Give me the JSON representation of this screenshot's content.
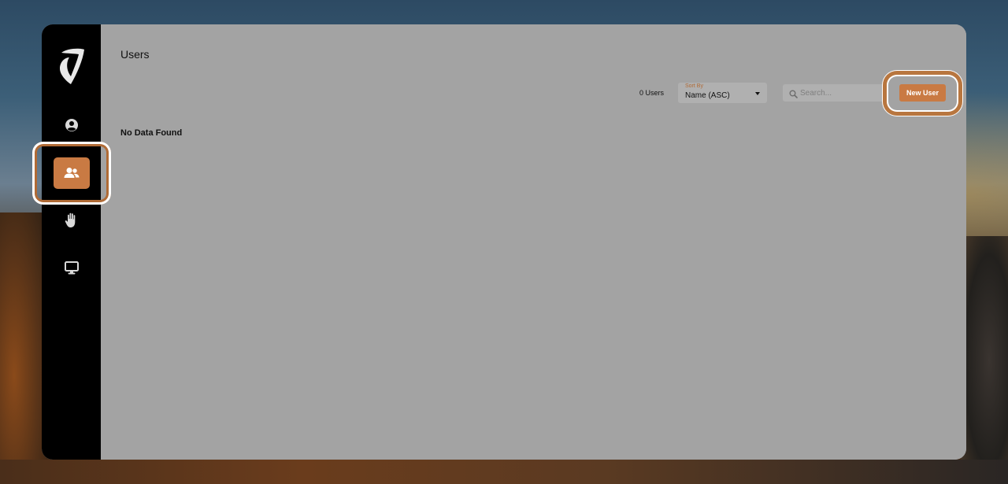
{
  "page": {
    "title": "Users"
  },
  "sidebar": {
    "items": [
      {
        "name": "profile",
        "icon": "user-circle-icon",
        "active": false
      },
      {
        "name": "users",
        "icon": "users-icon",
        "active": true
      },
      {
        "name": "permissions",
        "icon": "hand-icon",
        "active": false
      },
      {
        "name": "devices",
        "icon": "monitor-icon",
        "active": false
      }
    ]
  },
  "toolbar": {
    "count_text": "0 Users",
    "sort_label": "Sort By",
    "sort_value": "Name (ASC)",
    "search_placeholder": "Search...",
    "new_user_label": "New User"
  },
  "content": {
    "empty_text": "No Data Found"
  },
  "colors": {
    "accent": "#c97a43",
    "highlight": "#b06b36",
    "sidebar": "#000000",
    "panel": "#a3a3a3"
  }
}
